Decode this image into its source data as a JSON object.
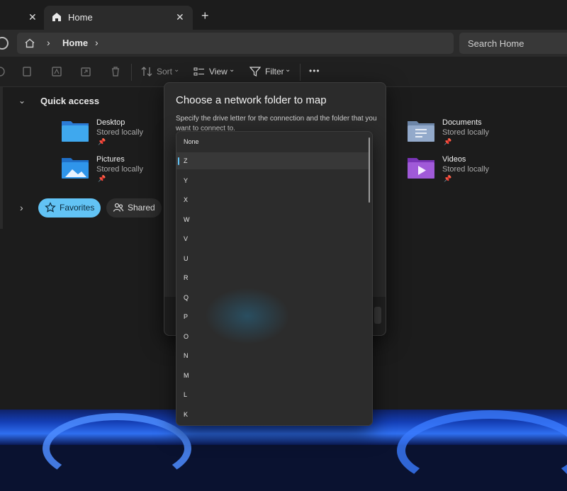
{
  "tabs": [
    {
      "label": "",
      "close_icon": "close-icon"
    },
    {
      "label": "Home",
      "icon": "home-icon",
      "close_icon": "close-icon"
    }
  ],
  "new_tab_label": "+",
  "address": {
    "crumb": "Home",
    "chevron": "›"
  },
  "search": {
    "placeholder": "Search Home"
  },
  "toolbar": {
    "sort_label": "Sort",
    "view_label": "View",
    "filter_label": "Filter",
    "more_label": "•••"
  },
  "quick_access": {
    "title": "Quick access"
  },
  "folders": [
    {
      "name": "Desktop",
      "status": "Stored locally",
      "icon": "desktop-folder-icon",
      "color": "#3a9be8"
    },
    {
      "name": "Documents",
      "status": "Stored locally",
      "icon": "documents-folder-icon",
      "color": "#8aa4c8"
    },
    {
      "name": "Pictures",
      "status": "Stored locally",
      "icon": "pictures-folder-icon",
      "color": "#2f8ff0"
    },
    {
      "name": "Videos",
      "status": "Stored locally",
      "icon": "videos-folder-icon",
      "color": "#9a4fd6"
    }
  ],
  "chips": {
    "favorites": "Favorites",
    "shared": "Shared"
  },
  "dialog": {
    "title": "Choose a network folder to map",
    "description": "Specify the drive letter for the connection and the folder that you want to connect to."
  },
  "drive_options": [
    "None",
    "Z",
    "Y",
    "X",
    "W",
    "V",
    "U",
    "R",
    "Q",
    "P",
    "O",
    "N",
    "M",
    "L",
    "K"
  ],
  "selected_drive": "Z",
  "colors": {
    "accent": "#62c3f5",
    "window_bg": "#202020"
  }
}
